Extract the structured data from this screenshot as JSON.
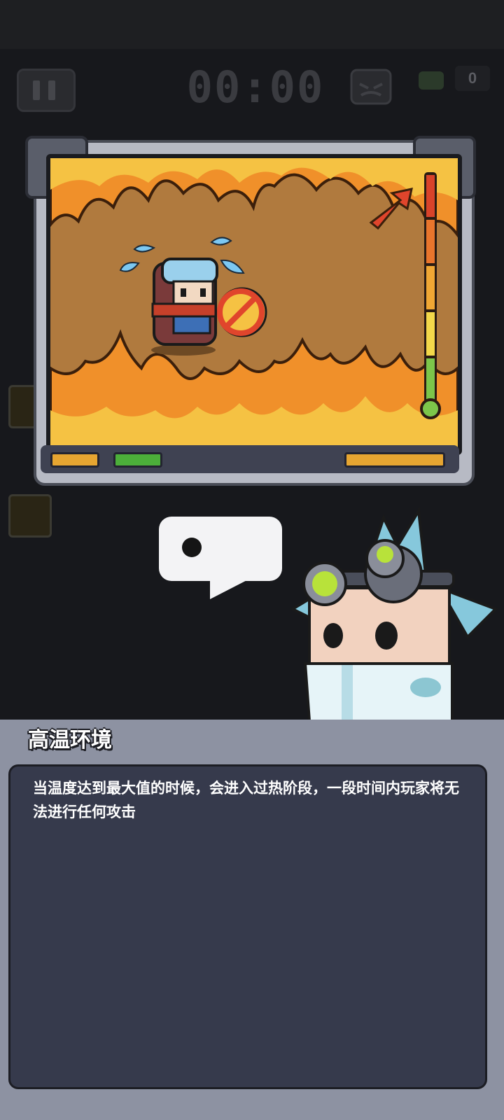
{
  "hud": {
    "timer": "00:00",
    "kill_count": "0",
    "icons": [
      "pause-icon",
      "enemy-skull-icon",
      "kill-counter-icon"
    ]
  },
  "tutorial_monitor": {
    "illustration": "overheated-character-in-fire",
    "temperature_gauge_level": 1.0,
    "indicator_colors": [
      "#e6a531",
      "#4caf3a",
      "#e6a531"
    ]
  },
  "speech_bubble": {
    "icon": "dot-icon"
  },
  "info_panel": {
    "title": "高温环境",
    "description": "当温度达到最大值的时候，会进入过热阶段，一段时间内玩家将无法进行任何攻击"
  },
  "colors": {
    "panel_bg": "#8d92a2",
    "desc_bg": "#363a4c",
    "fire_orange": "#f0902a",
    "fire_yellow": "#f5c243"
  }
}
